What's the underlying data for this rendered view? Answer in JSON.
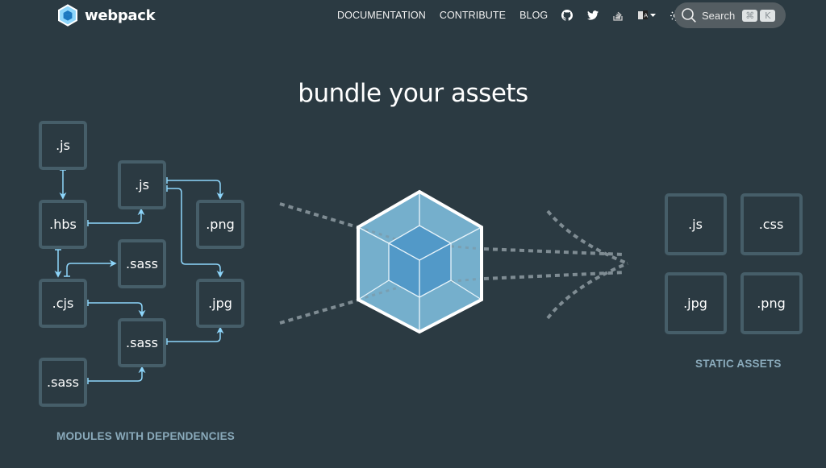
{
  "header": {
    "brand": "webpack",
    "nav_links": [
      "DOCUMENTATION",
      "CONTRIBUTE",
      "BLOG"
    ],
    "icons": [
      "github-icon",
      "twitter-icon",
      "stack-overflow-icon",
      "language-icon",
      "theme-toggle-icon"
    ],
    "search": {
      "label": "Search",
      "shortcut_keys": [
        "⌘",
        "K"
      ]
    }
  },
  "hero": {
    "title": "bundle your assets"
  },
  "modules": {
    "caption": "MODULES WITH DEPENDENCIES",
    "boxes": [
      ".js",
      ".hbs",
      ".cjs",
      ".sass",
      ".js",
      ".sass",
      ".sass",
      ".png",
      ".jpg"
    ]
  },
  "static_assets": {
    "caption": "STATIC ASSETS",
    "boxes": [
      ".js",
      ".css",
      ".jpg",
      ".png"
    ]
  },
  "colors": {
    "background": "#2b3a42",
    "box_border": "#465e69",
    "arrow": "#8ed6fb",
    "caption": "#8aaabb",
    "cube_outer": "#75afcc",
    "cube_inner": "#5299c8",
    "dashes": "#7f8c93"
  }
}
